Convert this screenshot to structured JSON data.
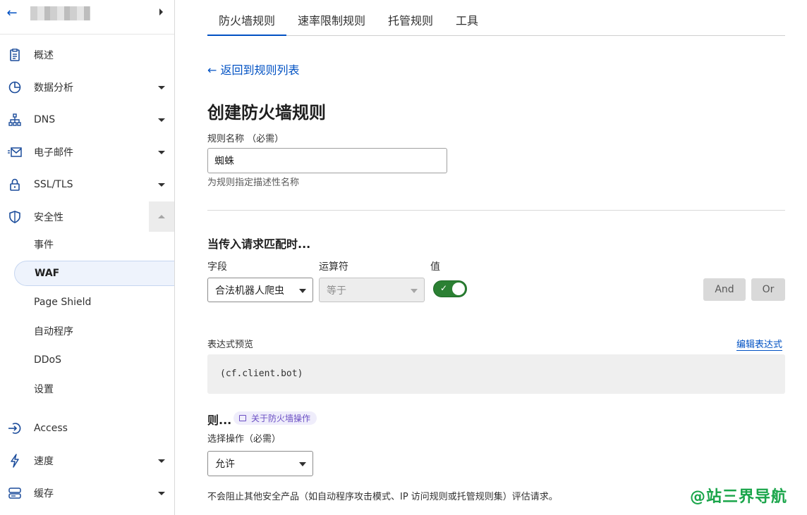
{
  "sidebar": {
    "nav": [
      {
        "label": "概述",
        "icon": "document-icon"
      },
      {
        "label": "数据分析",
        "icon": "pie-chart-icon"
      },
      {
        "label": "DNS",
        "icon": "network-icon"
      },
      {
        "label": "电子邮件",
        "icon": "email-icon"
      },
      {
        "label": "SSL/TLS",
        "icon": "lock-icon"
      },
      {
        "label": "安全性",
        "icon": "shield-icon"
      }
    ],
    "security_sub": [
      {
        "label": "事件"
      },
      {
        "label": "WAF"
      },
      {
        "label": "Page Shield"
      },
      {
        "label": "自动程序"
      },
      {
        "label": "DDoS"
      },
      {
        "label": "设置"
      }
    ],
    "nav_bottom": [
      {
        "label": "Access",
        "icon": "access-icon"
      },
      {
        "label": "速度",
        "icon": "lightning-icon"
      },
      {
        "label": "缓存",
        "icon": "storage-icon"
      }
    ]
  },
  "tabs": [
    "防火墙规则",
    "速率限制规则",
    "托管规则",
    "工具"
  ],
  "back_link": "← 返回到规则列表",
  "page_title": "创建防火墙规则",
  "rule_name": {
    "label": "规则名称 （必需）",
    "value": "蜘蛛",
    "help": "为规则指定描述性名称"
  },
  "match": {
    "title": "当传入请求匹配时...",
    "field_label": "字段",
    "operator_label": "运算符",
    "value_label": "值",
    "field_value": "合法机器人爬虫",
    "operator_value": "等于",
    "toggle_on": true,
    "and_label": "And",
    "or_label": "Or"
  },
  "expression": {
    "label": "表达式预览",
    "edit_link": "编辑表达式",
    "code": "(cf.client.bot)"
  },
  "then": {
    "title": "则...",
    "pill": "关于防火墙操作",
    "action_label": "选择操作（必需）",
    "action_value": "允许",
    "note": "不会阻止其他安全产品（如自动程序攻击模式、IP 访问规则或托管规则集）评估请求。"
  },
  "watermark": "@站三界导航",
  "colors": {
    "accent": "#0051c3",
    "toggle_on": "#2b8033",
    "watermark": "#1aa54a"
  }
}
